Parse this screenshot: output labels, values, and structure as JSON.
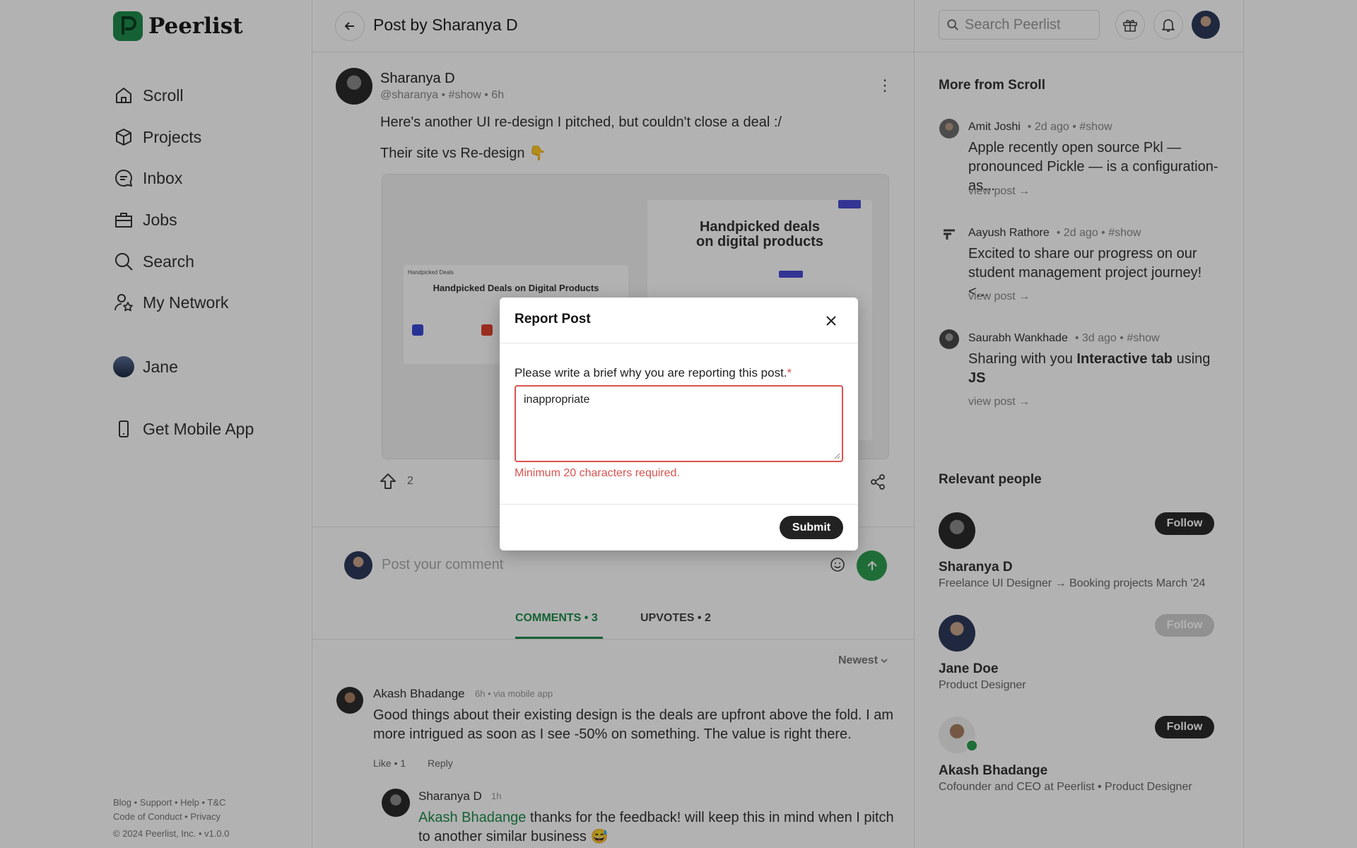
{
  "brand": {
    "name": "Peerlist",
    "accent": "#1f8b4c"
  },
  "sidebar": {
    "items": [
      {
        "label": "Scroll",
        "icon": "home-icon"
      },
      {
        "label": "Projects",
        "icon": "cube-icon"
      },
      {
        "label": "Inbox",
        "icon": "chat-icon"
      },
      {
        "label": "Jobs",
        "icon": "briefcase-icon"
      },
      {
        "label": "Search",
        "icon": "search-icon"
      },
      {
        "label": "My Network",
        "icon": "network-icon"
      }
    ],
    "user": "Jane",
    "mobile_app": "Get Mobile App",
    "footer": {
      "line1": "Blog • Support • Help • T&C",
      "line2": "Code of Conduct • Privacy",
      "line3": "© 2024 Peerlist, Inc. • v1.0.0"
    }
  },
  "header": {
    "title": "Post by Sharanya D",
    "search_placeholder": "Search Peerlist"
  },
  "post": {
    "author": "Sharanya D",
    "meta": "@sharanya • #show • 6h",
    "text1": "Here's another UI re-design I pitched, but couldn't close a deal :/",
    "text2": "Their site vs Re-design 👇",
    "img_left_title": "Handpicked Deals on Digital Products",
    "img_left_brand": "Handpicked Deals",
    "img_right_title": "Handpicked deals on digital products",
    "upvotes": "2"
  },
  "comment_box": {
    "placeholder": "Post your comment"
  },
  "tabs": {
    "comments": "COMMENTS • 3",
    "upvotes": "UPVOTES • 2"
  },
  "sort": "Newest",
  "comments": [
    {
      "author": "Akash Bhadange",
      "meta": "6h • via mobile app",
      "text": "Good things about their existing design is the deals are upfront above the fold. I am more intrigued as soon as I see -50% on something. The value is right there.",
      "like": "Like • 1",
      "reply": "Reply"
    },
    {
      "author": "Sharanya D",
      "meta": "1h",
      "mention": "Akash Bhadange",
      "text": " thanks for the feedback! will keep this in mind when I pitch to another similar business 😅"
    }
  ],
  "right": {
    "more_title": "More from Scroll",
    "more": [
      {
        "author": "Amit Joshi",
        "meta": "• 2d ago • #show",
        "text": "Apple recently open source Pkl — pronounced Pickle — is a configuration-as...",
        "link": "view post →"
      },
      {
        "author": "Aayush Rathore",
        "meta": "• 2d ago • #show",
        "text": "Excited to share our progress on our student management project journey! <...",
        "link": "view post →"
      },
      {
        "author": "Saurabh Wankhade",
        "meta": "• 3d ago • #show",
        "text_a": "Sharing with you ",
        "text_b": "Interactive tab",
        "text_c": " using ",
        "text_d": "JS",
        "link": "view post →"
      }
    ],
    "people_title": "Relevant people",
    "people": [
      {
        "name": "Sharanya D",
        "role": "Freelance UI Designer → Booking projects March '24",
        "follow": "Follow"
      },
      {
        "name": "Jane Doe",
        "role": "Product Designer",
        "follow": "Follow"
      },
      {
        "name": "Akash Bhadange",
        "role": "Cofounder and CEO at Peerlist • Product Designer",
        "follow": "Follow"
      }
    ]
  },
  "modal": {
    "title": "Report Post",
    "label": "Please write a brief why you are reporting this post.",
    "required": "*",
    "value": "inappropriate",
    "error": "Minimum 20 characters required.",
    "submit": "Submit",
    "error_color": "#d9534f"
  }
}
